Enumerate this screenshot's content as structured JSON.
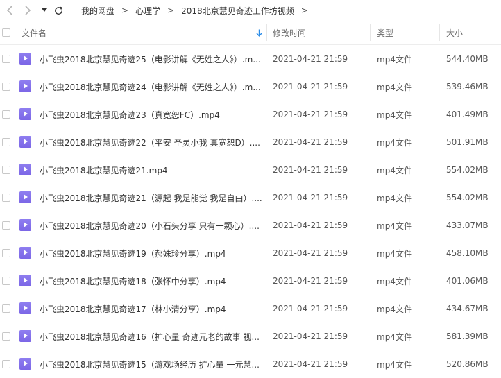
{
  "breadcrumb": [
    "我的网盘",
    "心理学",
    "2018北京慧见奇迹工作坊视频"
  ],
  "breadcrumb_separator": ">",
  "columns": {
    "name": "文件名",
    "modified": "修改时间",
    "type": "类型",
    "size": "大小"
  },
  "files": [
    {
      "name": "小飞虫2018北京慧见奇迹25（电影讲解《无姓之人》）.m...",
      "modified": "2021-04-21 21:59",
      "type": "mp4文件",
      "size": "544.40MB"
    },
    {
      "name": "小飞虫2018北京慧见奇迹24（电影讲解《无姓之人》）.m...",
      "modified": "2021-04-21 21:59",
      "type": "mp4文件",
      "size": "539.46MB"
    },
    {
      "name": "小飞虫2018北京慧见奇迹23（真宽恕FC）.mp4",
      "modified": "2021-04-21 21:59",
      "type": "mp4文件",
      "size": "401.49MB"
    },
    {
      "name": "小飞虫2018北京慧见奇迹22（平安 圣灵小我 真宽恕D）....",
      "modified": "2021-04-21 21:59",
      "type": "mp4文件",
      "size": "501.91MB"
    },
    {
      "name": "小飞虫2018北京慧见奇迹21.mp4",
      "modified": "2021-04-21 21:59",
      "type": "mp4文件",
      "size": "554.02MB"
    },
    {
      "name": "小飞虫2018北京慧见奇迹21（源起 我是能觉 我是自由）....",
      "modified": "2021-04-21 21:59",
      "type": "mp4文件",
      "size": "554.02MB"
    },
    {
      "name": "小飞虫2018北京慧见奇迹20（小石头分享 只有一颗心）....",
      "modified": "2021-04-21 21:59",
      "type": "mp4文件",
      "size": "433.07MB"
    },
    {
      "name": "小飞虫2018北京慧见奇迹19（郝姝玲分享）.mp4",
      "modified": "2021-04-21 21:59",
      "type": "mp4文件",
      "size": "458.10MB"
    },
    {
      "name": "小飞虫2018北京慧见奇迹18（张怀中分享）.mp4",
      "modified": "2021-04-21 21:59",
      "type": "mp4文件",
      "size": "401.06MB"
    },
    {
      "name": "小飞虫2018北京慧见奇迹17（林小清分享）.mp4",
      "modified": "2021-04-21 21:59",
      "type": "mp4文件",
      "size": "434.67MB"
    },
    {
      "name": "小飞虫2018北京慧见奇迹16（扩心量 奇迹元老的故事 视...",
      "modified": "2021-04-21 21:59",
      "type": "mp4文件",
      "size": "581.39MB"
    },
    {
      "name": "小飞虫2018北京慧见奇迹15（游戏场经历 扩心量 一元慧...",
      "modified": "2021-04-21 21:59",
      "type": "mp4文件",
      "size": "520.86MB"
    }
  ],
  "colors": {
    "file_icon": "#7b66e6",
    "sort_arrow": "#2a8ce8"
  }
}
